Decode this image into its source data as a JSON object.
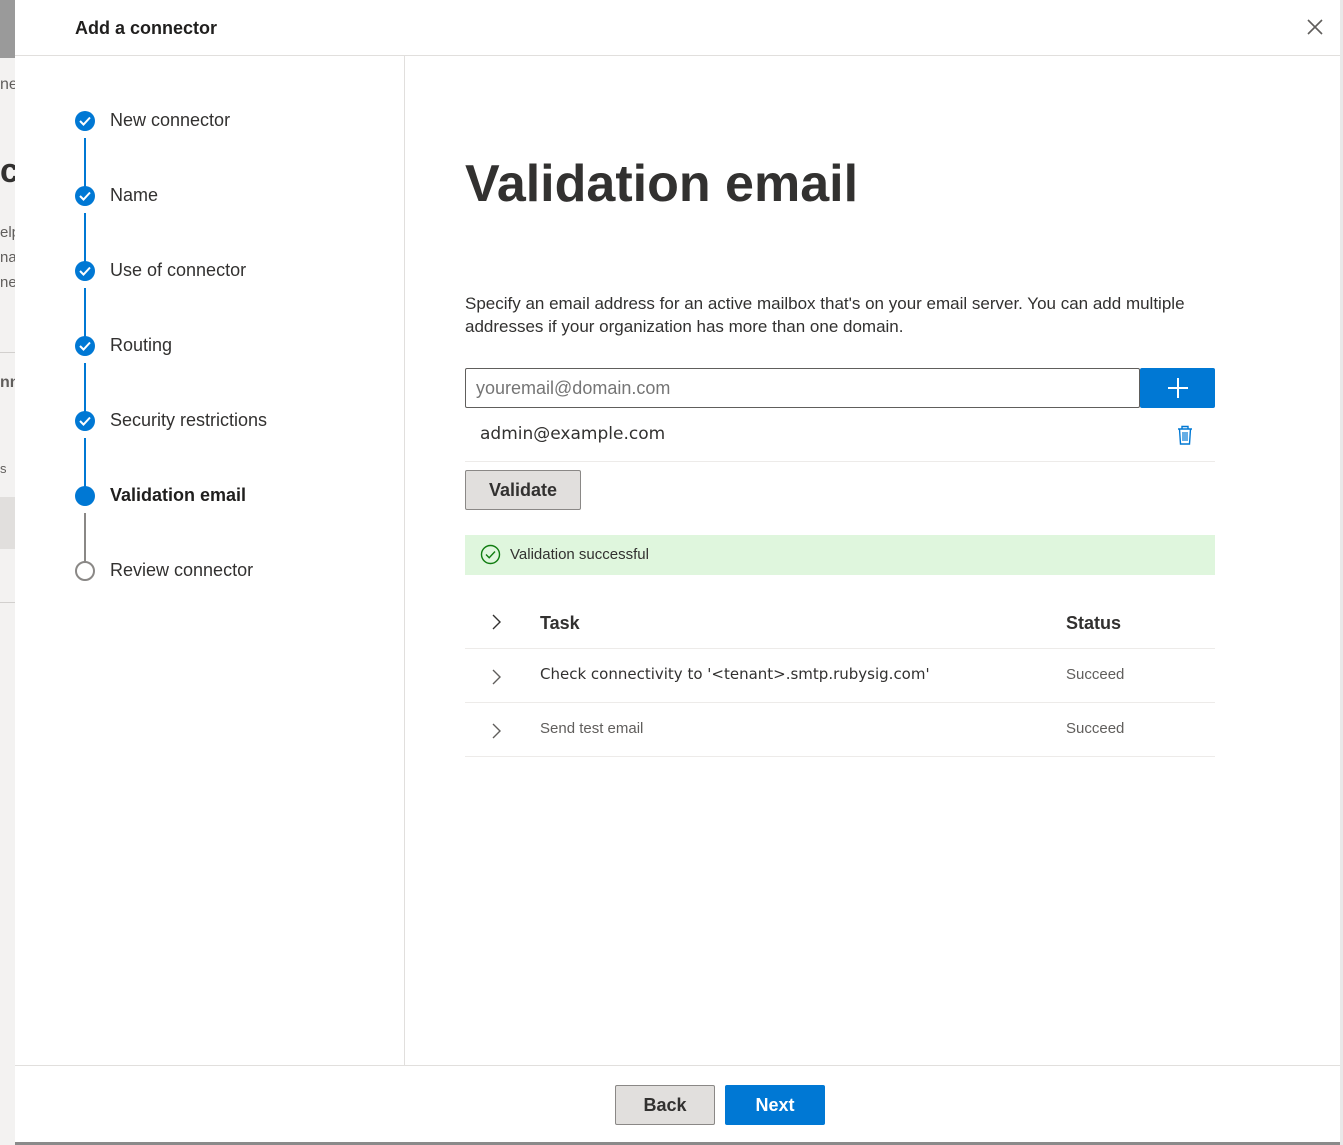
{
  "dialog": {
    "title": "Add a connector",
    "close_icon": "close-icon"
  },
  "background_fragments": [
    "ne",
    "ct",
    "elp",
    "nat",
    "ner",
    "nn",
    "s"
  ],
  "steps": [
    {
      "label": "New connector",
      "state": "done"
    },
    {
      "label": "Name",
      "state": "done"
    },
    {
      "label": "Use of connector",
      "state": "done"
    },
    {
      "label": "Routing",
      "state": "done"
    },
    {
      "label": "Security restrictions",
      "state": "done"
    },
    {
      "label": "Validation email",
      "state": "current"
    },
    {
      "label": "Review connector",
      "state": "todo"
    }
  ],
  "main": {
    "title": "Validation email",
    "description": "Specify an email address for an active mailbox that's on your email server. You can add multiple addresses if your organization has more than one domain.",
    "email_input": {
      "value": "",
      "placeholder": "youremail@domain.com"
    },
    "add_icon": "plus-icon",
    "email_list": [
      {
        "address": "admin@example.com",
        "icon": "trash-icon"
      }
    ],
    "validate_label": "Validate",
    "status": {
      "icon": "check-circle-icon",
      "text": "Validation successful"
    },
    "table": {
      "headers": {
        "task": "Task",
        "status": "Status"
      },
      "rows": [
        {
          "task": "Check connectivity to '<tenant>.smtp.rubysig.com'",
          "status": "Succeed"
        },
        {
          "task": "Send test email",
          "status": "Succeed"
        }
      ]
    }
  },
  "footer": {
    "back_label": "Back",
    "next_label": "Next"
  },
  "colors": {
    "accent": "#0078d4",
    "success_bg": "#dff6dd",
    "success_icon": "#107c10"
  }
}
